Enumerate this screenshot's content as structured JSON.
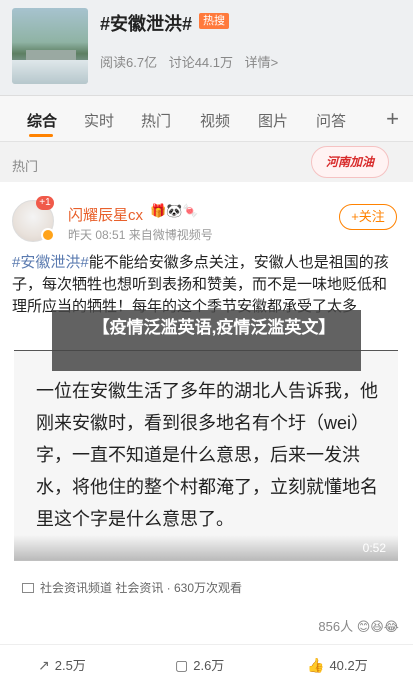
{
  "topic": {
    "title": "#安徽泄洪#",
    "hot_badge": "热搜",
    "reads": "阅读6.7亿",
    "discussions": "讨论44.1万",
    "details": "详情>"
  },
  "tabs": [
    "综合",
    "实时",
    "热门",
    "视频",
    "图片",
    "问答"
  ],
  "tab_plus": "+",
  "section": {
    "label": "热门",
    "logo_text": "河南加油"
  },
  "post": {
    "avatar_badge": "+1",
    "username": "闪耀辰星cx",
    "username_emojis": "🎁🐼🍬",
    "meta": "昨天 08:51  来自微博视频号",
    "follow": "+关注",
    "hashtag": "#安徽泄洪#",
    "text": "能不能给安徽多点关注，安徽人也是祖国的孩子，每次牺牲也想听到表扬和赞美，而不是一味地贬低和理所应当的牺牲！每年的这个季节安徽都承受了太多",
    "overlay": "【疫情泛滥英语,疫情泛滥英文】",
    "video_text": "一位在安徽生活了多年的湖北人告诉我，他刚来安徽时，看到很多地名有个圩（wei）字，一直不知道是什么意思，后来一发洪水，将他住的整个村都淹了，立刻就懂地名里这个字是什么意思了。",
    "duration": "0:52",
    "source": "社会资讯频道 社会资讯 · 630万次观看",
    "likes": "856人",
    "likes_emojis": "😊😆😂"
  },
  "actions": {
    "share": "2.5万",
    "comment": "2.6万",
    "like": "40.2万"
  },
  "colors": {
    "accent": "#ff8200",
    "hashtag": "#5b7bb0",
    "username": "#e8602c"
  }
}
